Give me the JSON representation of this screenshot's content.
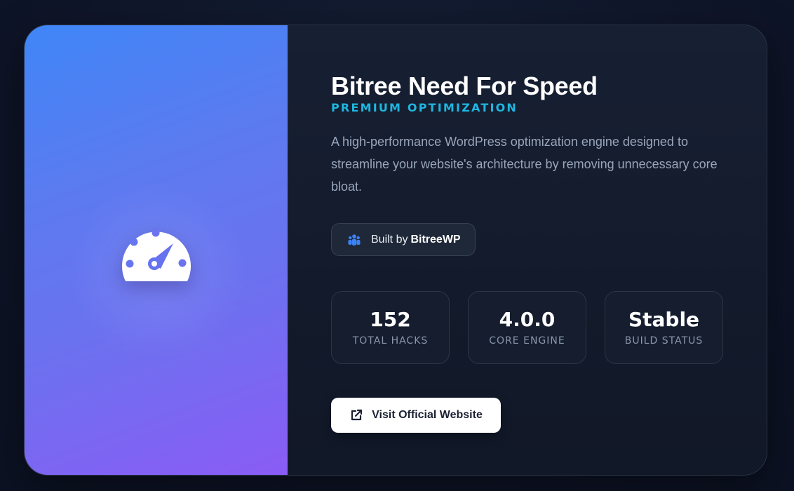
{
  "product": {
    "title": "Bitree Need For Speed",
    "subtitle": "PREMIUM OPTIMIZATION",
    "description": "A high-performance WordPress optimization engine designed to streamline your website's architecture by removing unnecessary core bloat."
  },
  "author": {
    "prefix": "Built by",
    "name": "BitreeWP",
    "icon": "users-icon"
  },
  "stats": [
    {
      "value": "152",
      "label": "TOTAL HACKS"
    },
    {
      "value": "4.0.0",
      "label": "CORE ENGINE"
    },
    {
      "value": "Stable",
      "label": "BUILD STATUS"
    }
  ],
  "cta": {
    "label": "Visit Official Website",
    "icon": "external-link-icon"
  },
  "hero": {
    "icon": "speedometer-icon"
  },
  "colors": {
    "accent": "#1fb6e0",
    "icon_blue": "#3b82f6",
    "hero_start": "#3f86f7",
    "hero_end": "#8a5cf5"
  }
}
